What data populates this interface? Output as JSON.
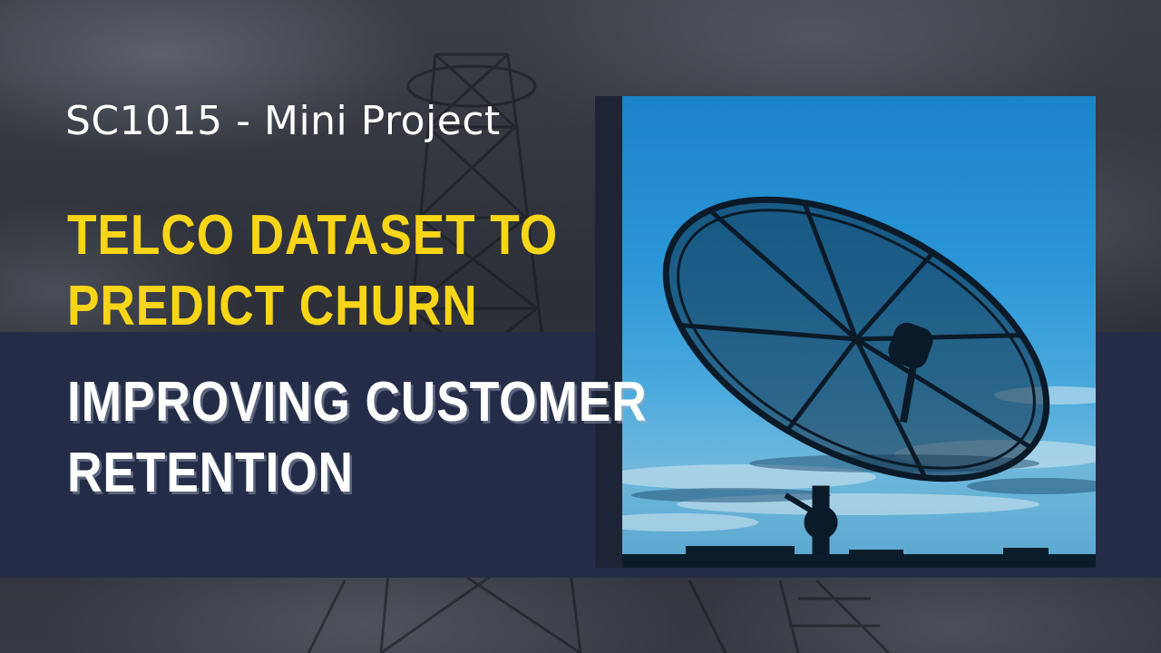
{
  "slide": {
    "subtitle": "SC1015 - Mini Project",
    "title_line_1": "TELCO DATASET TO",
    "title_line_2": "PREDICT CHURN",
    "tagline_line_1": "IMPROVING CUSTOMER",
    "tagline_line_2": "RETENTION"
  },
  "colors": {
    "accent_yellow": "#f7d518",
    "band_navy": "#252c47",
    "text_white": "#ffffff"
  },
  "icons": {
    "background": "telecom-tower-icon",
    "photo": "satellite-dish-icon"
  }
}
